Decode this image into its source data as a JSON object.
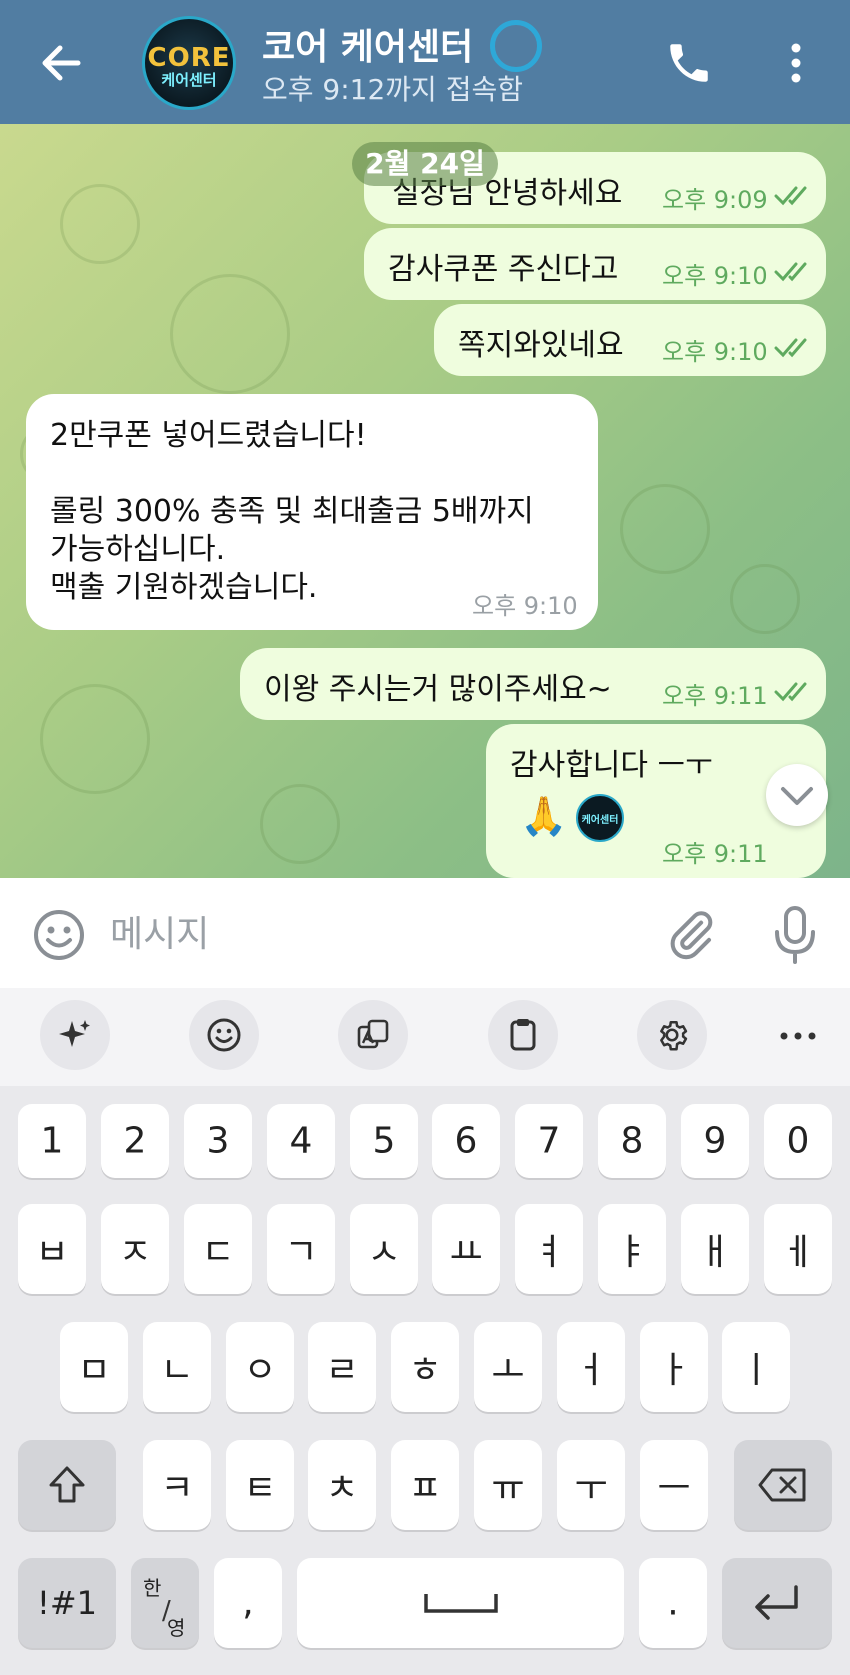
{
  "header": {
    "title": "코어 케어센터",
    "status": "오후 9:12까지 접속함",
    "avatar_logo_top": "CORE",
    "avatar_logo_sub": "케어센터",
    "icons": {
      "back": "arrow-left-icon",
      "call": "phone-icon",
      "menu": "more-vertical-icon"
    },
    "color": "#517da2"
  },
  "chat": {
    "date_label": "2월 24일",
    "messages": [
      {
        "dir": "out",
        "lines": [
          "실장님 안녕하세요"
        ],
        "time": "오후 9:09",
        "read": true
      },
      {
        "dir": "out",
        "lines": [
          "감사쿠폰 주신다고"
        ],
        "time": "오후 9:10",
        "read": true
      },
      {
        "dir": "out",
        "lines": [
          "쪽지와있네요"
        ],
        "time": "오후 9:10",
        "read": true
      },
      {
        "dir": "in",
        "lines": [
          "2만쿠폰 넣어드렸습니다!",
          "",
          "롤링 300% 충족 및 최대출금 5배까지",
          "가능하십니다.",
          "맥출 기원하겠습니다."
        ],
        "time": "오후 9:10"
      },
      {
        "dir": "out",
        "lines": [
          "이왕 주시는거 많이주세요~"
        ],
        "time": "오후 9:11",
        "read": true
      },
      {
        "dir": "out",
        "lines": [
          "감사합니다 ㅡㅜ"
        ],
        "time": "오후 9:11",
        "read": true,
        "emoji": "🙏",
        "sticker_text": "케어센터"
      }
    ]
  },
  "input": {
    "placeholder": "메시지",
    "icons": {
      "emoji": "smiley-icon",
      "attach": "paperclip-icon",
      "mic": "microphone-icon"
    }
  },
  "keyboard": {
    "toolbar": [
      "sparkle-icon",
      "emoji-icon",
      "translate-icon",
      "clipboard-icon",
      "settings-icon",
      "more-icon"
    ],
    "number_row": [
      "1",
      "2",
      "3",
      "4",
      "5",
      "6",
      "7",
      "8",
      "9",
      "0"
    ],
    "row1": [
      "ㅂ",
      "ㅈ",
      "ㄷ",
      "ㄱ",
      "ㅅ",
      "ㅛ",
      "ㅕ",
      "ㅑ",
      "ㅐ",
      "ㅔ"
    ],
    "row2": [
      "ㅁ",
      "ㄴ",
      "ㅇ",
      "ㄹ",
      "ㅎ",
      "ㅗ",
      "ㅓ",
      "ㅏ",
      "ㅣ"
    ],
    "row3": [
      "ㅋ",
      "ㅌ",
      "ㅊ",
      "ㅍ",
      "ㅠ",
      "ㅜ",
      "ㅡ"
    ],
    "symbols_key": "!#1",
    "lang_key_top": "한",
    "lang_key_bottom": "영",
    "comma_key": ",",
    "period_key": "."
  }
}
